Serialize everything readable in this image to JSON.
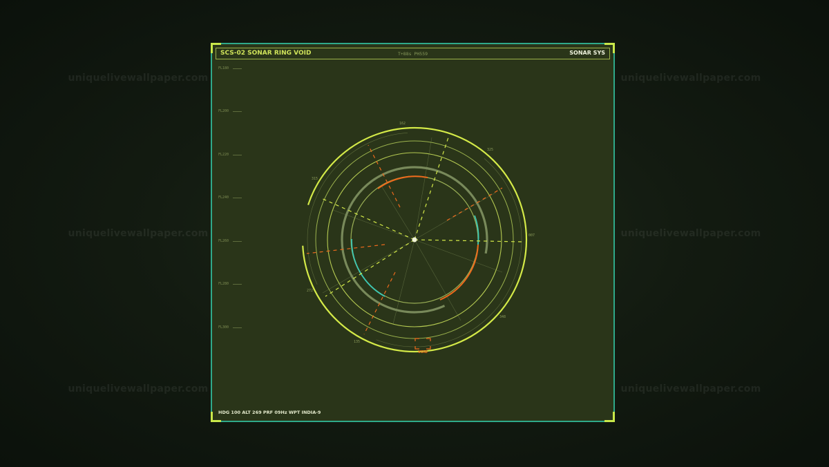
{
  "header": {
    "title": "SCS-02  SONAR RING VOID",
    "center": "T+88s PH559",
    "right": "SONAR SYS"
  },
  "altitude_scale": [
    "FL180",
    "FL200",
    "FL220",
    "FL240",
    "FL260",
    "FL280",
    "FL300"
  ],
  "bearing_labels": {
    "top": "162",
    "upper_right": "325",
    "right": "007",
    "lower_right": "348",
    "lower_left_bottom": "135",
    "lower_left": "272",
    "upper_left": "315"
  },
  "void_marker": "VOID",
  "status_bar": "HDG 100  ALT 269  PRF 09Hz  WPT INDIA-9",
  "watermark": "uniquelivewallpaper.com",
  "colors": {
    "panel_bg": "#2a3519",
    "panel_border": "#2fa98a",
    "accent_lime": "#d4ea48",
    "ring_green": "#8fa65a",
    "orange": "#ee6a1c",
    "cyan": "#3cc7b4"
  }
}
